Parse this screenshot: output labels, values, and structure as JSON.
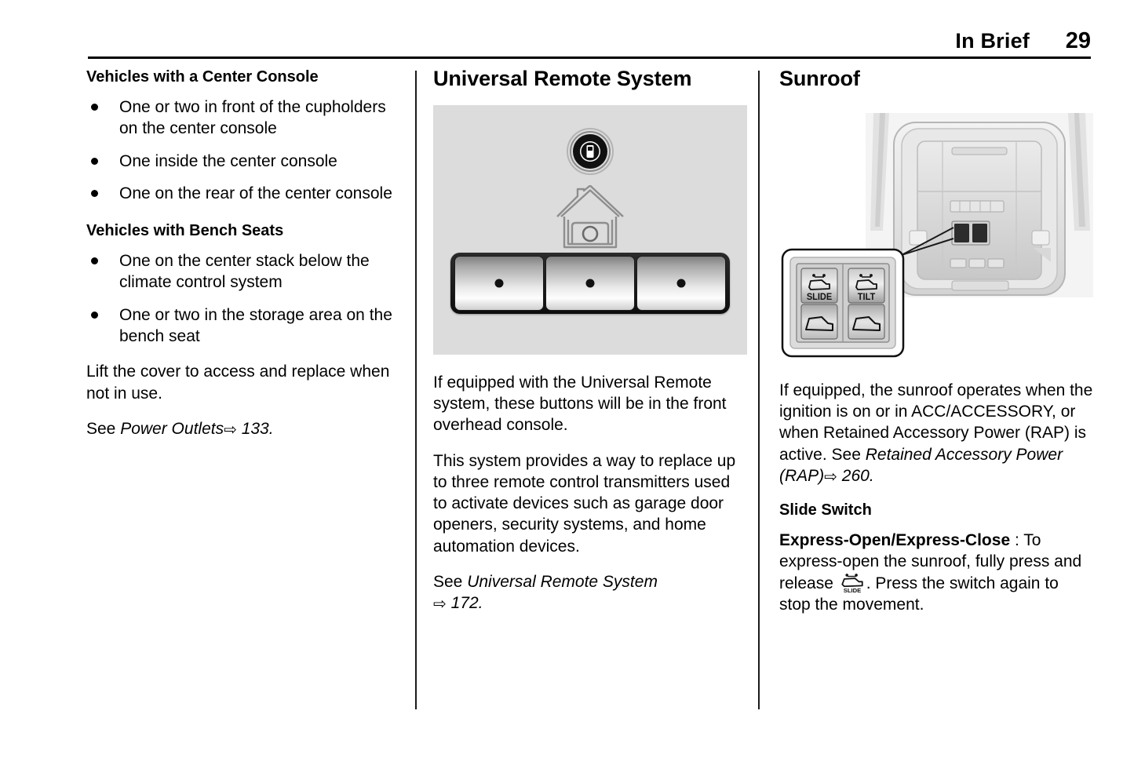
{
  "header": {
    "title": "In Brief",
    "page_number": "29"
  },
  "columns": {
    "left": {
      "heading_1": "Vehicles with a Center Console",
      "bullets_1": [
        "One or two in front of the cupholders on the center console",
        "One inside the center console",
        "One on the rear of the center console"
      ],
      "heading_2": "Vehicles with Bench Seats",
      "bullets_2": [
        "One on the center stack below the climate control system",
        "One or two in the storage area on the bench seat"
      ],
      "paragraph_1": "Lift the cover to access and replace when not in use.",
      "see_prefix": "See ",
      "see_ref_title": "Power Outlets",
      "see_ref_arrow": "⇨",
      "see_ref_page": "133."
    },
    "middle": {
      "heading": "Universal Remote System",
      "figure": {
        "label": "universal-remote-overhead-console-buttons",
        "background_color": "#dcdcdc",
        "button_count": 3,
        "icons": [
          "transmitter-led-icon",
          "house-garage-icon"
        ]
      },
      "paragraph_1": "If equipped with the Universal Remote system, these buttons will be in the front overhead console.",
      "paragraph_2": "This system provides a way to replace up to three remote control transmitters used to activate devices such as garage door openers, security systems, and home automation devices.",
      "see_prefix": "See ",
      "see_ref_title": "Universal Remote System",
      "see_ref_arrow": "⇨",
      "see_ref_page": "172."
    },
    "right": {
      "heading": "Sunroof",
      "figure": {
        "label": "sunroof-switch-overhead-console",
        "switch_labels": [
          "SLIDE",
          "TILT"
        ]
      },
      "paragraph_1_a": "If equipped, the sunroof operates when the ignition is on or in ACC/ACCESSORY, or when Retained Accessory Power (RAP) is active. See ",
      "paragraph_1_ref": "Retained Accessory Power (RAP)",
      "paragraph_1_arrow": "⇨",
      "paragraph_1_page": "260.",
      "heading_2": "Slide Switch",
      "express_label": "Express-Open/Express-Close",
      "express_sep": " : To express-open the sunroof, fully press and release ",
      "express_tail": ". Press the switch again to stop the movement."
    }
  }
}
